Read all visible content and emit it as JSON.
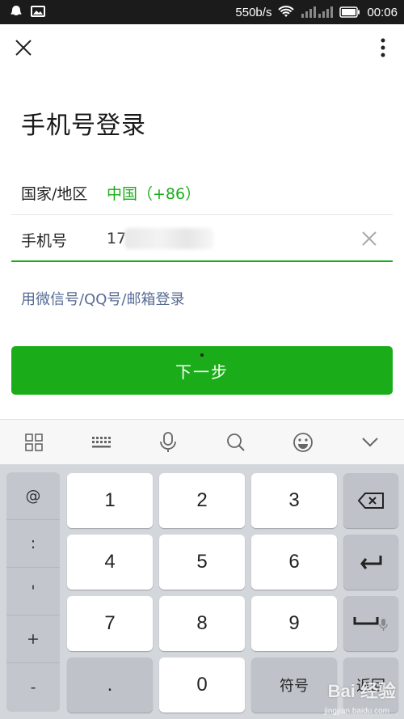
{
  "status_bar": {
    "speed": "550b/s",
    "time": "00:06",
    "icons": [
      "notification-icon",
      "image-icon",
      "wifi-icon",
      "signal-icon",
      "battery-icon"
    ]
  },
  "header": {
    "close_icon": "close-icon",
    "more_icon": "more-vertical-icon"
  },
  "page": {
    "title": "手机号登录"
  },
  "form": {
    "country_label": "国家/地区",
    "country_value": "中国（+86）",
    "phone_label": "手机号",
    "phone_value": "17",
    "alt_login": "用微信号/QQ号/邮箱登录",
    "next_button": "下一步"
  },
  "keyboard": {
    "toolbar": [
      "grid-icon",
      "keyboard-icon",
      "microphone-icon",
      "search-icon",
      "emoji-icon",
      "chevron-down-icon"
    ],
    "symbols": [
      "@",
      ":",
      "'",
      "+",
      "-"
    ],
    "digits": [
      "1",
      "2",
      "3",
      "4",
      "5",
      "6",
      "7",
      "8",
      "9",
      "0"
    ],
    "dot": ".",
    "symbol_key": "符号",
    "return_key": "返回",
    "backspace_icon": "backspace-icon",
    "enter_icon": "enter-icon",
    "space_icon": "space-icon"
  },
  "watermark": {
    "text": "Bai 经验",
    "sub": "jingyan.baidu.com"
  },
  "colors": {
    "accent": "#1aad19",
    "link": "#576b95",
    "status_bar": "#1b1b1b",
    "keyboard_bg": "#d3d6db"
  }
}
